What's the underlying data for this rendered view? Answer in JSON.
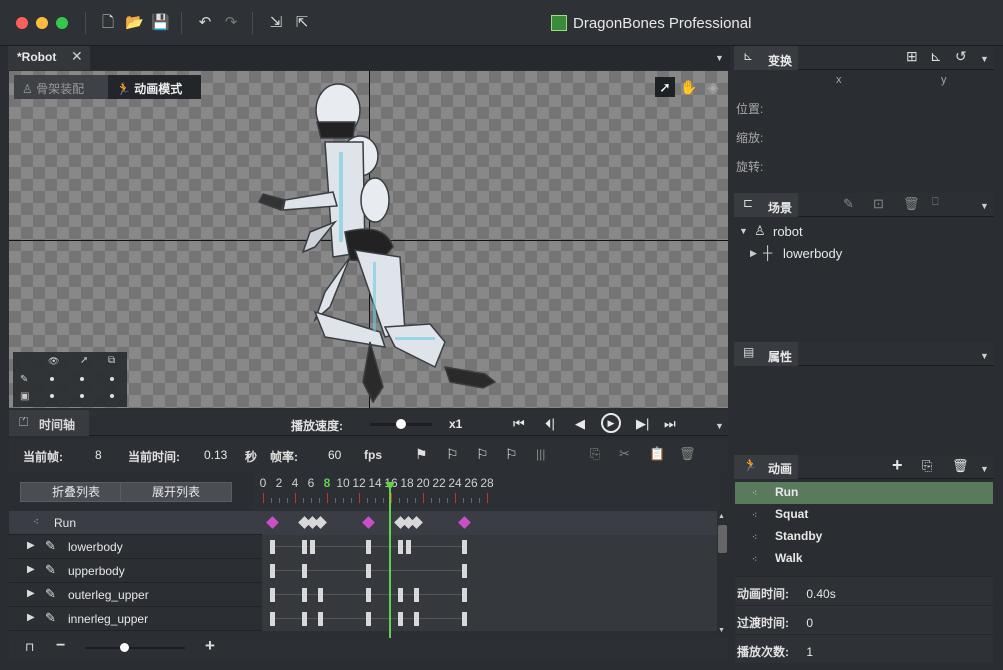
{
  "app": {
    "title": "DragonBones Professional"
  },
  "doc_tab": {
    "label": "*Robot"
  },
  "mode": {
    "armature": "骨架装配",
    "animate": "动画模式"
  },
  "timeline": {
    "tab": "时间轴",
    "speed_label": "播放速度:",
    "speed_value": "x1",
    "current_frame_label": "当前帧:",
    "current_frame": "8",
    "current_time_label": "当前时间:",
    "current_time": "0.13",
    "sec": "秒",
    "fps_label": "帧率:",
    "fps": "60",
    "fps_unit": "fps",
    "collapse": "折叠列表",
    "expand": "展开列表",
    "ruler": [
      "0",
      "2",
      "4",
      "6",
      "8",
      "10",
      "12",
      "14",
      "16",
      "18",
      "20",
      "22",
      "24",
      "26",
      "28"
    ],
    "rows": [
      {
        "name": "Run",
        "type": "anim",
        "keys": [
          0,
          4,
          5,
          6,
          12,
          16,
          17,
          18,
          24
        ]
      },
      {
        "name": "lowerbody",
        "keys": [
          0,
          4,
          5,
          12,
          16,
          17,
          24
        ]
      },
      {
        "name": "upperbody",
        "keys": [
          0,
          4,
          12,
          24
        ]
      },
      {
        "name": "outerleg_upper",
        "keys": [
          0,
          4,
          6,
          12,
          16,
          18,
          24
        ]
      },
      {
        "name": "innerleg_upper",
        "keys": [
          0,
          4,
          6,
          12,
          16,
          18,
          24
        ]
      }
    ]
  },
  "transform": {
    "title": "变换",
    "col_x": "x",
    "col_y": "y",
    "pos": "位置:",
    "scale": "缩放:",
    "rot": "旋转:"
  },
  "scene": {
    "title": "场景",
    "root": "robot",
    "child": "lowerbody"
  },
  "props": {
    "title": "属性"
  },
  "anim": {
    "title": "动画",
    "items": [
      "Run",
      "Squat",
      "Standby",
      "Walk"
    ],
    "duration_label": "动画时间:",
    "duration": "0.40s",
    "fade_label": "过渡时间:",
    "fade": "0",
    "playtimes_label": "播放次数:",
    "playtimes": "1"
  },
  "colors": {
    "accent_green": "#5dd449",
    "keyframe_diamond": "#c94fc9",
    "selected_row": "#5a7a5e"
  }
}
